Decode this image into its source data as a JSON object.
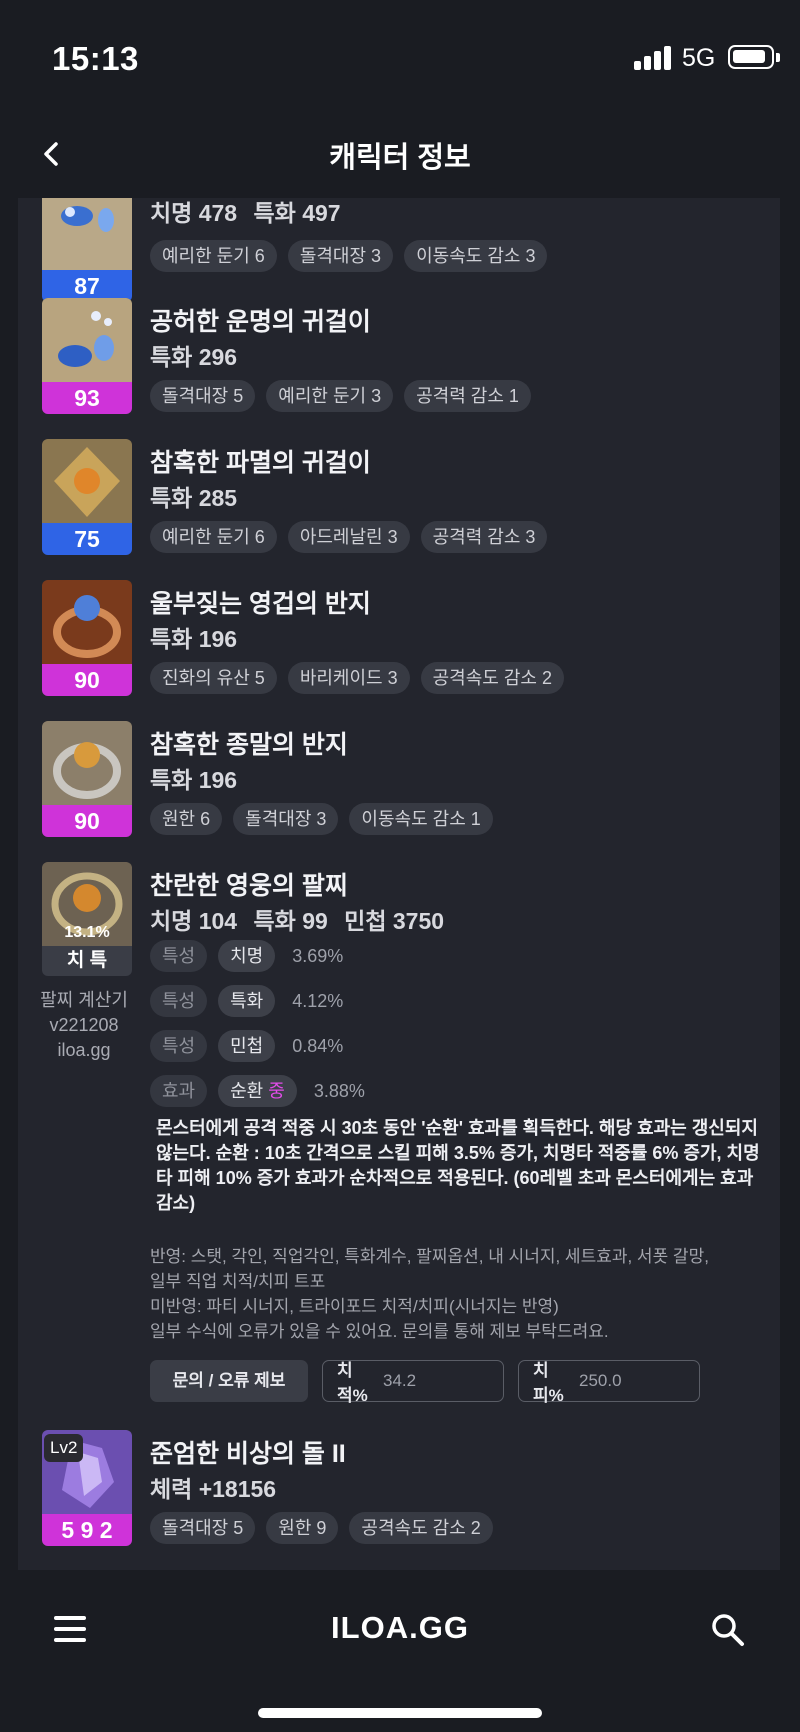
{
  "status": {
    "time": "15:13",
    "network": "5G"
  },
  "nav": {
    "title": "캐릭터 정보"
  },
  "items": [
    {
      "level": "87",
      "stats": [
        "치명 478",
        "특화 497"
      ],
      "tags": [
        "예리한 둔기 6",
        "돌격대장 3",
        "이동속도 감소 3"
      ]
    },
    {
      "name": "공허한 운명의 귀걸이",
      "level": "93",
      "stats": [
        "특화 296"
      ],
      "tags": [
        "돌격대장 5",
        "예리한 둔기 3",
        "공격력 감소 1"
      ]
    },
    {
      "name": "참혹한 파멸의 귀걸이",
      "level": "75",
      "stats": [
        "특화 285"
      ],
      "tags": [
        "예리한 둔기 6",
        "아드레날린 3",
        "공격력 감소 3"
      ]
    },
    {
      "name": "울부짖는 영겁의 반지",
      "level": "90",
      "stats": [
        "특화 196"
      ],
      "tags": [
        "진화의 유산 5",
        "바리케이드 3",
        "공격속도 감소 2"
      ]
    },
    {
      "name": "참혹한 종말의 반지",
      "level": "90",
      "stats": [
        "특화 196"
      ],
      "tags": [
        "원한 6",
        "돌격대장 3",
        "이동속도 감소 1"
      ]
    }
  ],
  "bracelet": {
    "name": "찬란한 영웅의 팔찌",
    "stats": [
      "치명 104",
      "특화 99",
      "민첩 3750"
    ],
    "percent": "13.1%",
    "short": "치 특",
    "calc_lines": [
      "팔찌 계산기",
      "v221208",
      "iloa.gg"
    ],
    "traits": [
      {
        "kind": "특성",
        "name": "치명",
        "value": "3.69%"
      },
      {
        "kind": "특성",
        "name": "특화",
        "value": "4.12%"
      },
      {
        "kind": "특성",
        "name": "민첩",
        "value": "0.84%"
      }
    ],
    "effect_row": {
      "kind": "효과",
      "name": "순환",
      "grade": "중",
      "value": "3.88%"
    },
    "effect_text": "몬스터에게 공격 적중 시 30초 동안 '순환' 효과를 획득한다. 해당 효과는 갱신되지 않는다. 순환 : 10초 간격으로 스킬 피해 3.5% 증가, 치명타 적중률 6% 증가, 치명타 피해 10% 증가 효과가 순차적으로 적용된다. (60레벨 초과 몬스터에게는 효과 감소)",
    "notes": [
      "반영: 스탯, 각인, 직업각인, 특화계수, 팔찌옵션, 내 시너지, 세트효과, 서폿 갈망,",
      "일부 직업 치적/치피 트포",
      "미반영: 파티 시너지, 트라이포드 치적/치피(시너지는 반영)",
      "일부 수식에 오류가 있을 수 있어요. 문의를 통해 제보 부탁드려요."
    ],
    "report_label": "문의 / 오류 제보",
    "crit_rate": {
      "label": "치적%",
      "value": "34.2"
    },
    "crit_dmg": {
      "label": "치피%",
      "value": "250.0"
    }
  },
  "stone": {
    "name": "준엄한 비상의 돌 II",
    "badge": "Lv2",
    "level": "5 9 2",
    "stats": [
      "체력 +18156"
    ],
    "tags": [
      "돌격대장 5",
      "원한 9",
      "공격속도 감소 2"
    ]
  },
  "bottom": {
    "logo": "ILOA.GG"
  },
  "colors": {
    "blue_level": "#2f64e6",
    "pink_level": "#cf33d9",
    "panel": "#23252d",
    "background": "#1a1c22"
  }
}
